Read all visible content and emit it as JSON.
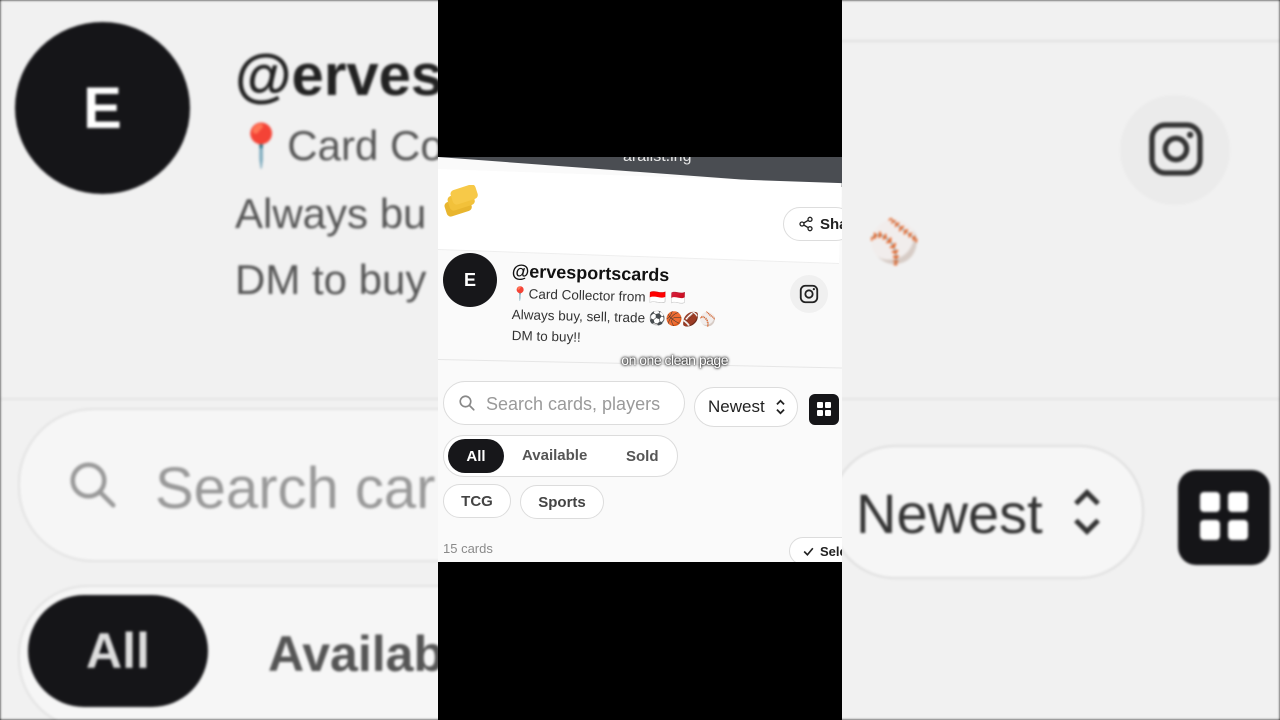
{
  "browser": {
    "url_fragment": "aralist.ing"
  },
  "profile": {
    "avatar_letter": "E",
    "handle": "@ervesportscards",
    "bio_line1": "📍Card Collector from 🇮🇩 🇲🇨",
    "bio_line2": "Always buy, sell, trade ⚽🏀🏈⚾",
    "bio_line3": "DM to buy!!"
  },
  "header": {
    "share_label": "Sha"
  },
  "caption": "on one clean page",
  "search": {
    "placeholder": "Search cards, players"
  },
  "sort": {
    "selected": "Newest"
  },
  "filters": {
    "status": [
      "All",
      "Available",
      "Sold"
    ],
    "active": "All",
    "tags": [
      "TCG",
      "Sports"
    ]
  },
  "results": {
    "count_label": "15 cards",
    "select_label": "Sele"
  },
  "background": {
    "handle_partial": "@erves",
    "bio_partial1": "📍Card Co",
    "bio_partial2": "Always bu",
    "bio_partial3": "DM to buy",
    "search_partial": "Search car",
    "available_partial": "Availab"
  },
  "colors": {
    "accent_logo": "#F7C948",
    "dark": "#151518"
  }
}
